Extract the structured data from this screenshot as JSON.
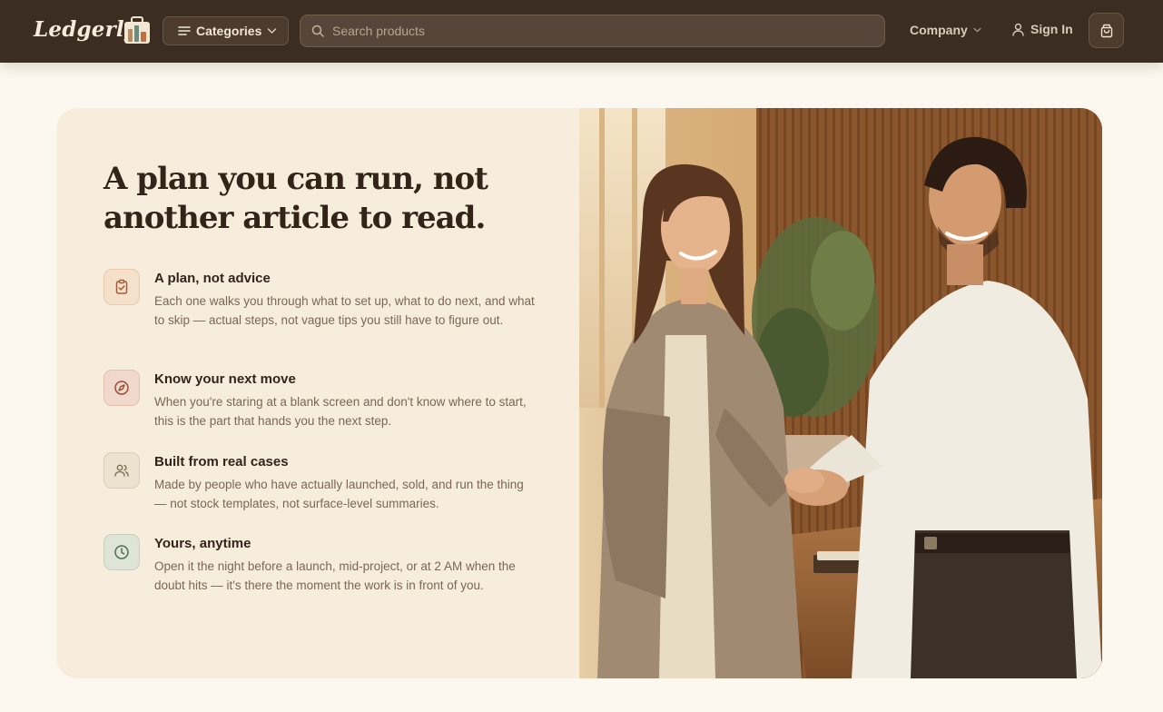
{
  "header": {
    "logo_text": "Ledgerly",
    "categories_label": "Categories",
    "search_placeholder": "Search products",
    "company_label": "Company",
    "signin_label": "Sign In"
  },
  "hero": {
    "headline_line1": "A plan you can run, not",
    "headline_line2": "another article to read.",
    "features": [
      {
        "icon": "clipboard-check-icon",
        "title": "A plan, not advice",
        "desc": "Each one walks you through what to set up, what to do next, and what to skip — actual steps, not vague tips you still have to figure out."
      },
      {
        "icon": "compass-icon",
        "title": "Know your next move",
        "desc": "When you're staring at a blank screen and don't know where to start, this is the part that hands you the next step."
      },
      {
        "icon": "users-icon",
        "title": "Built from real cases",
        "desc": "Made by people who have actually launched, sold, and run the thing — not stock templates, not surface-level summaries."
      },
      {
        "icon": "clock-icon",
        "title": "Yours, anytime",
        "desc": "Open it the night before a launch, mid-project, or at 2 AM when the doubt hits — it's there the moment the work is in front of you."
      }
    ]
  },
  "colors": {
    "header_bg": "#3b2d22",
    "page_bg": "#fcf8ef",
    "card_bg": "#f7eddd",
    "heading": "#33241a",
    "body_text": "#7b6655"
  }
}
